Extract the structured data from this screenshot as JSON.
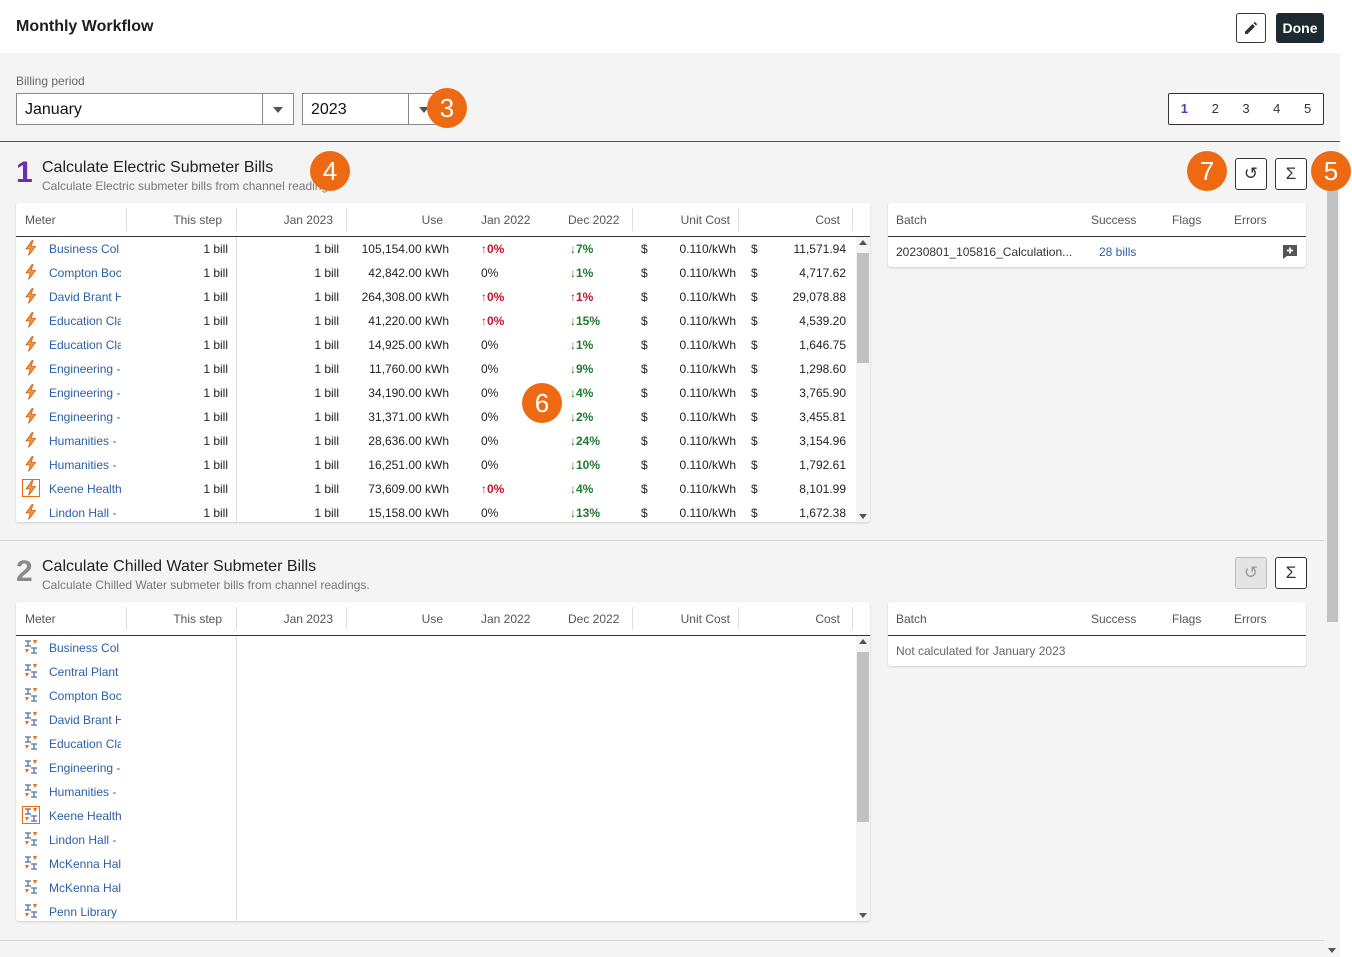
{
  "header": {
    "title": "Monthly Workflow",
    "done_label": "Done",
    "edit_icon": "pencil-icon"
  },
  "billing": {
    "label": "Billing period",
    "month": "January",
    "year": "2023"
  },
  "pager": {
    "pages": [
      "1",
      "2",
      "3",
      "4",
      "5"
    ],
    "active": "1"
  },
  "badges": {
    "b3": "3",
    "b4": "4",
    "b5": "5",
    "b6": "6",
    "b7": "7"
  },
  "colors": {
    "accent_purple": "#6a2fb0",
    "up_red": "#c0142e",
    "down_green": "#1f7a2e",
    "link_blue": "#2a5fa8",
    "badge_orange": "#ee6a12",
    "done_dark": "#1d2a30"
  },
  "columns": {
    "meter": "Meter",
    "this_step": "This step",
    "jan2023": "Jan 2023",
    "use": "Use",
    "jan2022": "Jan 2022",
    "dec2022": "Dec 2022",
    "unit_cost": "Unit Cost",
    "cost": "Cost"
  },
  "batch_columns": {
    "batch": "Batch",
    "success": "Success",
    "flags": "Flags",
    "errors": "Errors"
  },
  "step1": {
    "number": "1",
    "title": "Calculate Electric Submeter Bills",
    "subtitle": "Calculate Electric submeter bills from channel readings.",
    "rows": [
      {
        "meter": "Business Col",
        "step": "1 bill",
        "jan": "1 bill",
        "use": "105,154.00 kWh",
        "j22": "0%",
        "j22dir": "up",
        "d22": "7%",
        "d22dir": "down",
        "cur": "$",
        "unit": "0.110/kWh",
        "cur2": "$",
        "cost": "11,571.94"
      },
      {
        "meter": "Compton Boc",
        "step": "1 bill",
        "jan": "1 bill",
        "use": "42,842.00 kWh",
        "j22": "0%",
        "j22dir": "none",
        "d22": "1%",
        "d22dir": "down",
        "cur": "$",
        "unit": "0.110/kWh",
        "cur2": "$",
        "cost": "4,717.62"
      },
      {
        "meter": "David Brant H",
        "step": "1 bill",
        "jan": "1 bill",
        "use": "264,308.00 kWh",
        "j22": "0%",
        "j22dir": "up",
        "d22": "1%",
        "d22dir": "up",
        "cur": "$",
        "unit": "0.110/kWh",
        "cur2": "$",
        "cost": "29,078.88"
      },
      {
        "meter": "Education Cla",
        "step": "1 bill",
        "jan": "1 bill",
        "use": "41,220.00 kWh",
        "j22": "0%",
        "j22dir": "up",
        "d22": "15%",
        "d22dir": "down",
        "cur": "$",
        "unit": "0.110/kWh",
        "cur2": "$",
        "cost": "4,539.20"
      },
      {
        "meter": "Education Cla",
        "step": "1 bill",
        "jan": "1 bill",
        "use": "14,925.00 kWh",
        "j22": "0%",
        "j22dir": "none",
        "d22": "1%",
        "d22dir": "down",
        "cur": "$",
        "unit": "0.110/kWh",
        "cur2": "$",
        "cost": "1,646.75"
      },
      {
        "meter": "Engineering -",
        "step": "1 bill",
        "jan": "1 bill",
        "use": "11,760.00 kWh",
        "j22": "0%",
        "j22dir": "none",
        "d22": "9%",
        "d22dir": "down",
        "cur": "$",
        "unit": "0.110/kWh",
        "cur2": "$",
        "cost": "1,298.60"
      },
      {
        "meter": "Engineering -",
        "step": "1 bill",
        "jan": "1 bill",
        "use": "34,190.00 kWh",
        "j22": "0%",
        "j22dir": "none",
        "d22": "4%",
        "d22dir": "down",
        "cur": "$",
        "unit": "0.110/kWh",
        "cur2": "$",
        "cost": "3,765.90"
      },
      {
        "meter": "Engineering -",
        "step": "1 bill",
        "jan": "1 bill",
        "use": "31,371.00 kWh",
        "j22": "0%",
        "j22dir": "none",
        "d22": "2%",
        "d22dir": "down",
        "cur": "$",
        "unit": "0.110/kWh",
        "cur2": "$",
        "cost": "3,455.81"
      },
      {
        "meter": "Humanities -",
        "step": "1 bill",
        "jan": "1 bill",
        "use": "28,636.00 kWh",
        "j22": "0%",
        "j22dir": "none",
        "d22": "24%",
        "d22dir": "down",
        "cur": "$",
        "unit": "0.110/kWh",
        "cur2": "$",
        "cost": "3,154.96"
      },
      {
        "meter": "Humanities -",
        "step": "1 bill",
        "jan": "1 bill",
        "use": "16,251.00 kWh",
        "j22": "0%",
        "j22dir": "none",
        "d22": "10%",
        "d22dir": "down",
        "cur": "$",
        "unit": "0.110/kWh",
        "cur2": "$",
        "cost": "1,792.61"
      },
      {
        "meter": "Keene Health",
        "step": "1 bill",
        "jan": "1 bill",
        "use": "73,609.00 kWh",
        "j22": "0%",
        "j22dir": "up",
        "d22": "4%",
        "d22dir": "down",
        "cur": "$",
        "unit": "0.110/kWh",
        "cur2": "$",
        "cost": "8,101.99",
        "boxed": true
      },
      {
        "meter": "Lindon Hall -",
        "step": "1 bill",
        "jan": "1 bill",
        "use": "15,158.00 kWh",
        "j22": "0%",
        "j22dir": "none",
        "d22": "13%",
        "d22dir": "down",
        "cur": "$",
        "unit": "0.110/kWh",
        "cur2": "$",
        "cost": "1,672.38"
      }
    ],
    "batch": {
      "name": "20230801_105816_Calculation...",
      "success": "28 bills",
      "comment_icon": "comment-add-icon"
    }
  },
  "step2": {
    "number": "2",
    "title": "Calculate Chilled Water Submeter Bills",
    "subtitle": "Calculate Chilled Water submeter bills from channel readings.",
    "meters": [
      "Business Col",
      "Central Plant",
      "Compton Boc",
      "David Brant H",
      "Education Cla",
      "Engineering -",
      "Humanities -",
      "Keene Health",
      "Lindon Hall -",
      "McKenna Hal",
      "McKenna Hal",
      "Penn Library"
    ],
    "boxed_index": 7,
    "batch_empty": "Not calculated for January 2023"
  }
}
